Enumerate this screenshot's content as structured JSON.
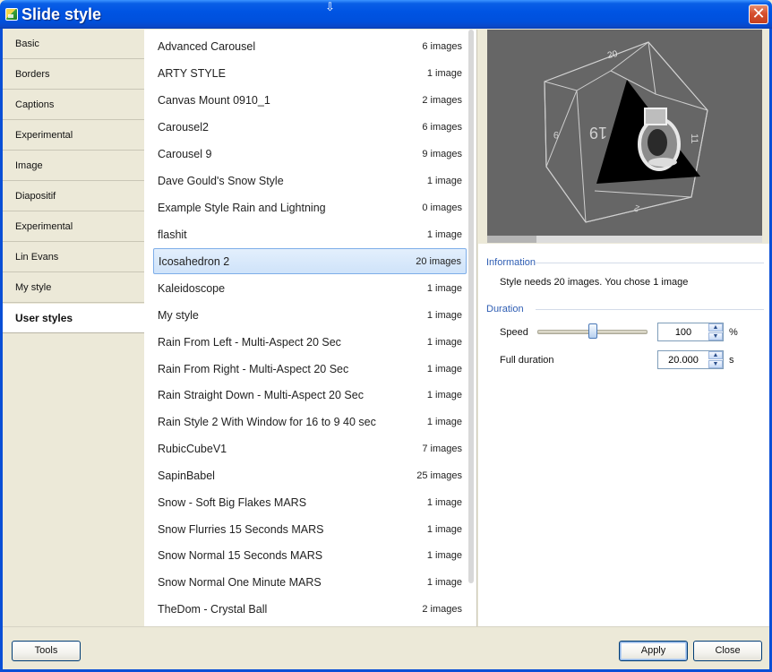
{
  "window": {
    "title": "Slide style",
    "close_glyph": "✕",
    "cursor_glyph": "⇩"
  },
  "categories": [
    {
      "label": "Basic"
    },
    {
      "label": "Borders"
    },
    {
      "label": "Captions"
    },
    {
      "label": "Experimental"
    },
    {
      "label": "Image"
    },
    {
      "label": "Diapositif"
    },
    {
      "label": "Experimental"
    },
    {
      "label": "Lin Evans"
    },
    {
      "label": "My style"
    },
    {
      "label": "User styles",
      "active": true
    }
  ],
  "styles": [
    {
      "name": "Advanced Carousel",
      "count": "6 images"
    },
    {
      "name": "ARTY STYLE",
      "count": "1 image"
    },
    {
      "name": "Canvas Mount 0910_1",
      "count": "2 images"
    },
    {
      "name": "Carousel2",
      "count": "6 images"
    },
    {
      "name": "Carousel 9",
      "count": "9 images"
    },
    {
      "name": "Dave Gould's Snow Style",
      "count": "1 image"
    },
    {
      "name": "Example Style Rain and Lightning",
      "count": "0 images"
    },
    {
      "name": "flashit",
      "count": "1 image"
    },
    {
      "name": "Icosahedron 2",
      "count": "20 images",
      "selected": true
    },
    {
      "name": "Kaleidoscope",
      "count": "1 image"
    },
    {
      "name": "My style",
      "count": "1 image"
    },
    {
      "name": "Rain From Left - Multi-Aspect 20 Sec",
      "count": "1 image"
    },
    {
      "name": "Rain From Right - Multi-Aspect 20 Sec",
      "count": "1 image"
    },
    {
      "name": "Rain Straight Down - Multi-Aspect 20 Sec",
      "count": "1 image"
    },
    {
      "name": "Rain Style 2 With Window for 16 to 9 40 sec",
      "count": "1 image"
    },
    {
      "name": "RubicCubeV1",
      "count": "7 images"
    },
    {
      "name": "SapinBabel",
      "count": "25 images"
    },
    {
      "name": "Snow - Soft Big Flakes MARS",
      "count": "1 image"
    },
    {
      "name": "Snow Flurries 15 Seconds MARS",
      "count": "1 image"
    },
    {
      "name": "Snow Normal 15 Seconds MARS",
      "count": "1 image"
    },
    {
      "name": "Snow Normal One Minute MARS",
      "count": "1 image"
    },
    {
      "name": "TheDom - Crystal Ball",
      "count": "2 images"
    }
  ],
  "preview": {
    "face_numbers": [
      "20",
      "19",
      "9",
      "11",
      "2"
    ],
    "progress": 0.18
  },
  "information": {
    "title": "Information",
    "text": "Style needs 20 images. You chose 1 image"
  },
  "duration": {
    "title": "Duration",
    "speed_label": "Speed",
    "speed_value": "100",
    "speed_unit": "%",
    "speed_slider_fraction": 0.5,
    "full_duration_label": "Full duration",
    "full_duration_value": "20.000",
    "full_duration_unit": "s",
    "spin_up_glyph": "▲",
    "spin_down_glyph": "▼"
  },
  "buttons": {
    "tools": "Tools",
    "apply": "Apply",
    "close": "Close"
  }
}
